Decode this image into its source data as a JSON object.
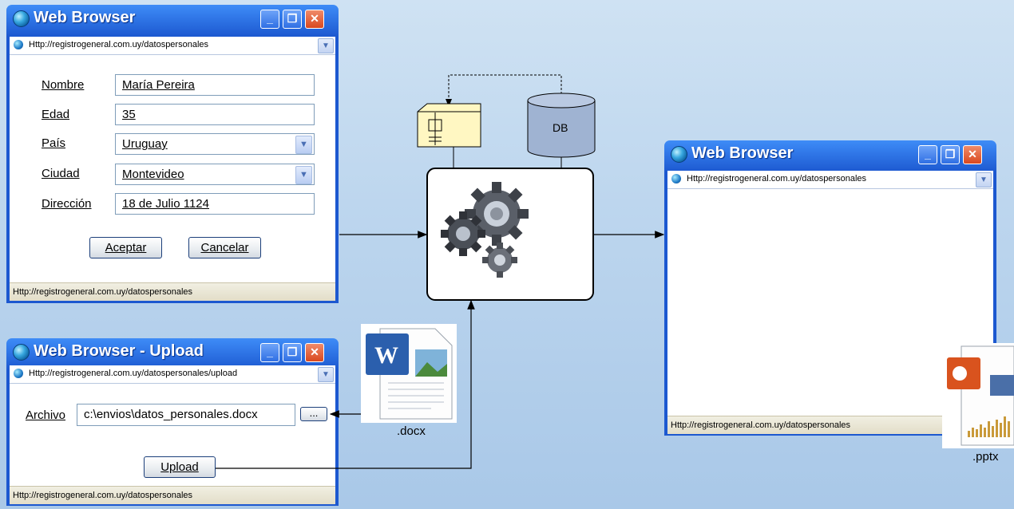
{
  "window_main": {
    "title": "Web Browser",
    "url": "Http://registrogeneral.com.uy/datospersonales",
    "status": "Http://registrogeneral.com.uy/datospersonales",
    "form": {
      "nombre_label": "Nombre",
      "nombre_value": "María Pereira",
      "edad_label": "Edad",
      "edad_value": "35",
      "pais_label": "País",
      "pais_value": "Uruguay",
      "ciudad_label": "Ciudad",
      "ciudad_value": "Montevideo",
      "direccion_label": "Dirección",
      "direccion_value": "18 de Julio 1124"
    },
    "accept_label": "Aceptar",
    "cancel_label": "Cancelar"
  },
  "window_upload": {
    "title": "Web Browser - Upload",
    "url": "Http://registrogeneral.com.uy/datospersonales/upload",
    "status": "Http://registrogeneral.com.uy/datospersonales",
    "archivo_label": "Archivo",
    "archivo_value": "c:\\envios\\datos_personales.docx",
    "browse_label": "...",
    "upload_label": "Upload"
  },
  "window_result": {
    "title": "Web Browser",
    "url": "Http://registrogeneral.com.uy/datospersonales",
    "status": "Http://registrogeneral.com.uy/datospersonales"
  },
  "diagram": {
    "db_label": "DB",
    "docx_label": ".docx",
    "pptx_label": ".pptx"
  },
  "colors": {
    "titlebar": "#2566de",
    "close_button": "#d9481f",
    "background": "#bdd6ee"
  }
}
